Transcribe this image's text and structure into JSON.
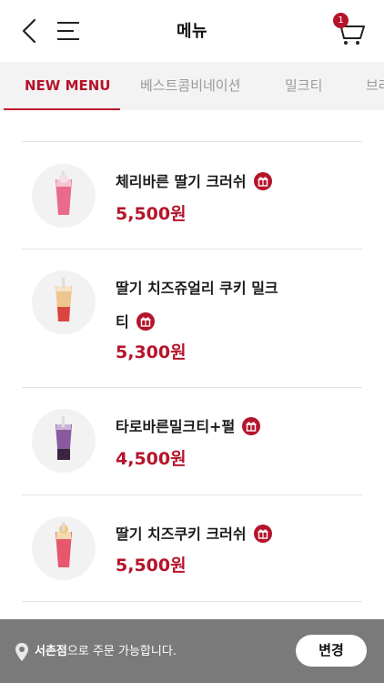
{
  "header": {
    "title": "메뉴",
    "cart_count": "1"
  },
  "tabs": [
    {
      "label": "NEW MENU",
      "active": true
    },
    {
      "label": "베스트콤비네이션",
      "active": false
    },
    {
      "label": "밀크티",
      "active": false
    },
    {
      "label": "브라",
      "active": false
    }
  ],
  "items": [
    {
      "name": "체리바른 딸기 크러쉬",
      "price": "5,500원",
      "icon": "gift-icon"
    },
    {
      "name_line1": "딸기 치즈쥬얼리 쿠키 밀크",
      "name_line2": "티",
      "price": "5,300원",
      "icon": "gift-icon"
    },
    {
      "name": "타로바른밀크티+펄",
      "price": "4,500원",
      "icon": "gift-icon"
    },
    {
      "name": "딸기 치즈쿠키 크러쉬",
      "price": "5,500원",
      "icon": "gift-icon"
    }
  ],
  "bottom": {
    "store_name": "서촌점",
    "store_suffix": "으로 주문 가능합니다.",
    "change_label": "변경"
  },
  "colors": {
    "accent": "#b5142b",
    "tab_bg": "#f3f3f3",
    "bottom_bg": "#7a7a7a"
  }
}
